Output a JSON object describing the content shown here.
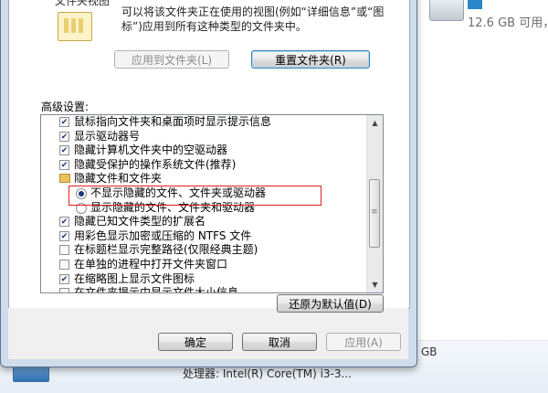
{
  "background": {
    "drive_text": "12.6 GB 可用，",
    "gb_text": "GB",
    "cpu_text": "处理器: Intel(R) Core(TM) i3-3..."
  },
  "folder_view": {
    "title": "文件夹视图",
    "description": "可以将该文件夹正在使用的视图(例如“详细信息”或“图标”)应用到所有这种类型的文件夹中。",
    "apply_label": "应用到文件夹(L)",
    "reset_label": "重置文件夹(R)"
  },
  "advanced": {
    "label": "高级设置:",
    "items": [
      {
        "type": "check",
        "checked": true,
        "label": "鼠标指向文件夹和桌面项时显示提示信息",
        "indent": 0
      },
      {
        "type": "check",
        "checked": true,
        "label": "显示驱动器号",
        "indent": 0
      },
      {
        "type": "check",
        "checked": true,
        "label": "隐藏计算机文件夹中的空驱动器",
        "indent": 0
      },
      {
        "type": "check",
        "checked": true,
        "label": "隐藏受保护的操作系统文件(推荐)",
        "indent": 0
      },
      {
        "type": "folder",
        "label": "隐藏文件和文件夹",
        "indent": 0
      },
      {
        "type": "radio",
        "checked": true,
        "label": "不显示隐藏的文件、文件夹或驱动器",
        "indent": 1
      },
      {
        "type": "radio",
        "checked": false,
        "label": "显示隐藏的文件、文件夹和驱动器",
        "indent": 1
      },
      {
        "type": "check",
        "checked": true,
        "label": "隐藏已知文件类型的扩展名",
        "indent": 0
      },
      {
        "type": "check",
        "checked": true,
        "label": "用彩色显示加密或压缩的 NTFS 文件",
        "indent": 0
      },
      {
        "type": "check",
        "checked": false,
        "label": "在标题栏显示完整路径(仅限经典主题)",
        "indent": 0
      },
      {
        "type": "check",
        "checked": false,
        "label": "在单独的进程中打开文件夹窗口",
        "indent": 0
      },
      {
        "type": "check",
        "checked": true,
        "label": "在缩略图上显示文件图标",
        "indent": 0
      },
      {
        "type": "check",
        "checked": false,
        "label": "在文件夹提示中显示文件大小信息",
        "indent": 0
      }
    ],
    "restore_label": "还原为默认值(D)"
  },
  "footer": {
    "ok_label": "确定",
    "cancel_label": "取消",
    "apply_label": "应用(A)"
  }
}
